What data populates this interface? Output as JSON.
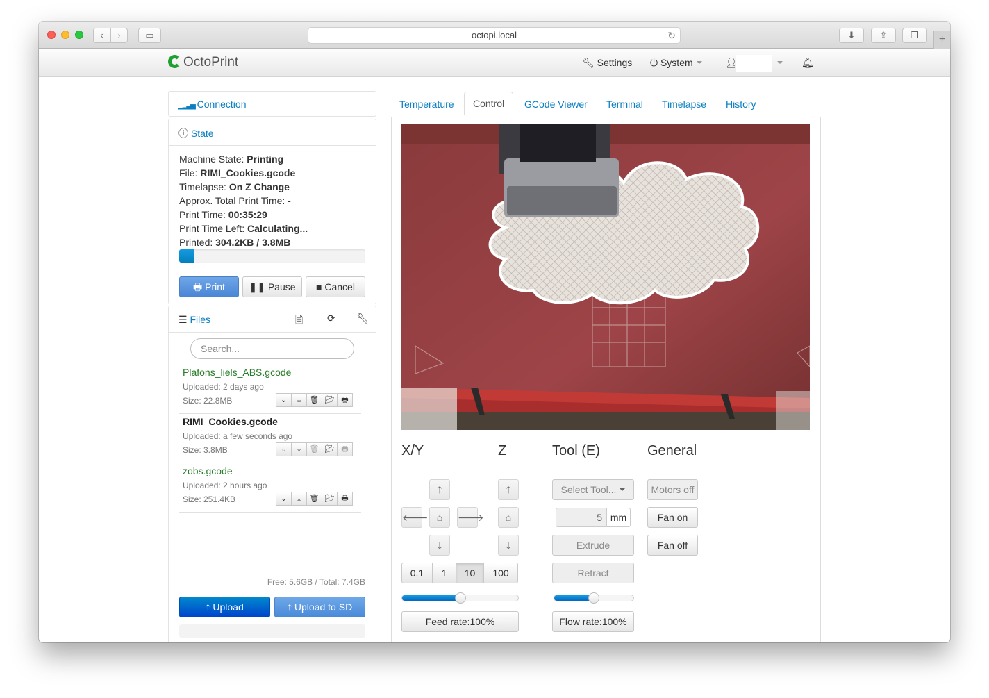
{
  "browser": {
    "url": "octopi.local"
  },
  "nav": {
    "brand": "OctoPrint",
    "settings": "Settings",
    "system": "System"
  },
  "sidebar": {
    "connection_title": "Connection",
    "state_title": "State",
    "state": {
      "machine_state_label": "Machine State:",
      "machine_state_value": "Printing",
      "file_label": "File:",
      "file_value": "RIMI_Cookies.gcode",
      "timelapse_label": "Timelapse:",
      "timelapse_value": "On Z Change",
      "approx_label": "Approx. Total Print Time:",
      "approx_value": "-",
      "print_time_label": "Print Time:",
      "print_time_value": "00:35:29",
      "time_left_label": "Print Time Left:",
      "time_left_value": "Calculating...",
      "printed_label": "Printed:",
      "printed_value": "304.2KB / 3.8MB",
      "progress": 0.08
    },
    "buttons": {
      "print": "Print",
      "pause": "Pause",
      "cancel": "Cancel"
    },
    "files_title": "Files",
    "search_placeholder": "Search...",
    "files": [
      {
        "name": "Plafons_liels_ABS.gcode",
        "uploaded": "Uploaded: 2 days ago",
        "size": "Size: 22.8MB"
      },
      {
        "name": "RIMI_Cookies.gcode",
        "uploaded": "Uploaded: a few seconds ago",
        "size": "Size: 3.8MB"
      },
      {
        "name": "zobs.gcode",
        "uploaded": "Uploaded: 2 hours ago",
        "size": "Size: 251.4KB"
      }
    ],
    "storage": "Free: 5.6GB / Total: 7.4GB",
    "upload": "Upload",
    "upload_sd": "Upload to SD"
  },
  "tabs": [
    "Temperature",
    "Control",
    "GCode Viewer",
    "Terminal",
    "Timelapse",
    "History"
  ],
  "control": {
    "xy_title": "X/Y",
    "z_title": "Z",
    "tool_title": "Tool (E)",
    "general_title": "General",
    "step_sizes": [
      "0.1",
      "1",
      "10",
      "100"
    ],
    "active_step": "10",
    "feed_rate": "Feed rate:100%",
    "feed_rate_level": 0.5,
    "flow_rate": "Flow rate:100%",
    "flow_rate_level": 0.5,
    "select_tool": "Select Tool...",
    "extrude_amount": "5",
    "unit": "mm",
    "extrude": "Extrude",
    "retract": "Retract",
    "motors_off": "Motors off",
    "fan_on": "Fan on",
    "fan_off": "Fan off"
  }
}
